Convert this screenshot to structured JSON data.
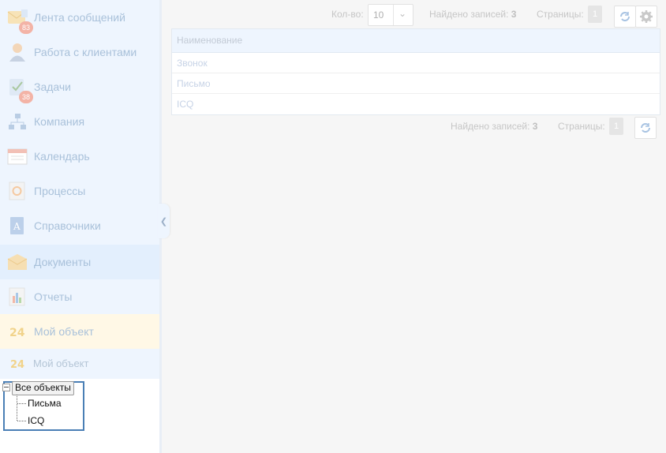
{
  "sidebar": {
    "items": [
      {
        "label": "Лента сообщений",
        "icon": "envelope-icon",
        "badge": "83"
      },
      {
        "label": "Работа с клиентами",
        "icon": "client-person-icon"
      },
      {
        "label": "Задачи",
        "icon": "tasks-checklist-icon",
        "badge": "38"
      },
      {
        "label": "Компания",
        "icon": "org-structure-icon"
      },
      {
        "label": "Календарь",
        "icon": "calendar-icon"
      },
      {
        "label": "Процессы",
        "icon": "processes-icon"
      },
      {
        "label": "Справочники",
        "icon": "directory-book-icon"
      },
      {
        "label": "Документы",
        "icon": "documents-folder-icon"
      },
      {
        "label": "Отчеты",
        "icon": "reports-chart-icon"
      },
      {
        "label": "Мой объект",
        "icon": "bitrix24-object-icon"
      }
    ],
    "sub_item": {
      "label": "Мой объект",
      "icon": "bitrix24-object-icon"
    },
    "tree": {
      "root": "Все объекты",
      "children": [
        "Письма",
        "ICQ"
      ]
    }
  },
  "toolbar": {
    "qty_label": "Кол-во:",
    "qty_value": "10",
    "found_label": "Найдено записей:",
    "found_count": "3",
    "pages_label": "Страницы:",
    "page_current": "1"
  },
  "grid": {
    "column_header": "Наименование",
    "rows": [
      "Звонок",
      "Письмо",
      "ICQ"
    ]
  },
  "footer": {
    "found_label": "Найдено записей:",
    "found_count": "3",
    "pages_label": "Страницы:",
    "page_current": "1"
  },
  "colors": {
    "sidebar_bg": "#eef5fe",
    "tree_highlight_border": "#4a7fb5",
    "badge": "#f3b3a6"
  }
}
